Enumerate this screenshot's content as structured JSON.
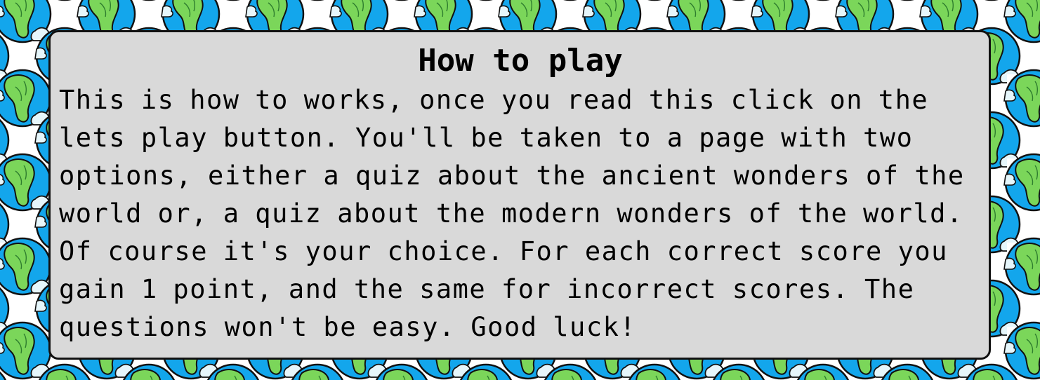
{
  "background": {
    "pattern_icon": "earth-globe-icon",
    "colors": {
      "ocean": "#13a6ec",
      "land": "#7bd65a",
      "cloud": "#e6f6fb",
      "outline": "#111111",
      "page": "#ffffff"
    }
  },
  "panel": {
    "title": "How to play",
    "body": "This is how to works, once you read this click on the lets play button. You'll be taken to a page with two options, either a quiz about the ancient wonders of the world or, a quiz about the modern wonders of the world. Of course it's your choice. For each correct score you gain 1 point, and the same for incorrect scores. The questions won't be easy. Good luck!",
    "background_color": "#d9d9d9",
    "border_color": "#111111"
  }
}
